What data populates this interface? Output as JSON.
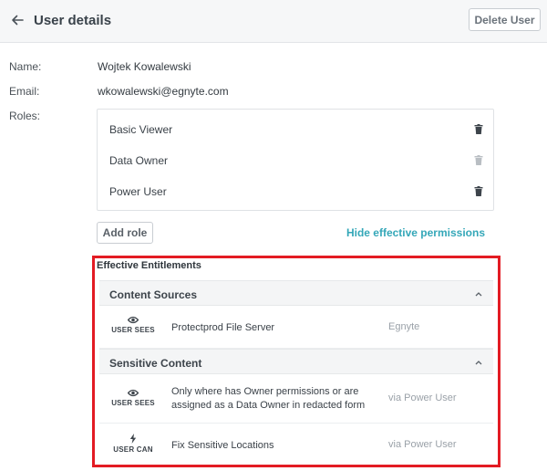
{
  "header": {
    "title": "User details",
    "delete_label": "Delete User"
  },
  "fields": {
    "name_label": "Name:",
    "name_value": "Wojtek Kowalewski",
    "email_label": "Email:",
    "email_value": "wkowalewski@egnyte.com",
    "roles_label": "Roles:"
  },
  "roles": [
    {
      "label": "Basic Viewer",
      "deletable": true
    },
    {
      "label": "Data Owner",
      "deletable": false
    },
    {
      "label": "Power User",
      "deletable": true
    }
  ],
  "actions": {
    "add_role_label": "Add role",
    "hide_permissions_label": "Hide effective permissions"
  },
  "entitlements": {
    "title": "Effective Entitlements",
    "sections": [
      {
        "label": "Content Sources",
        "rows": [
          {
            "icon": "eye-icon",
            "caption": "USER SEES",
            "desc_lines": [
              "Protectprod File Server"
            ],
            "source": "Egnyte"
          }
        ]
      },
      {
        "label": "Sensitive Content",
        "rows": [
          {
            "icon": "eye-icon",
            "caption": "USER SEES",
            "desc_lines": [
              "Only where has Owner permissions or are",
              "assigned as a Data Owner in redacted form"
            ],
            "source": "via Power User"
          },
          {
            "icon": "bolt-icon",
            "caption": "USER CAN",
            "desc_lines": [
              "Fix Sensitive Locations"
            ],
            "source": "via Power User"
          }
        ]
      }
    ]
  },
  "colors": {
    "accent_link": "#34a7b8",
    "highlight_border": "#e31b23",
    "trash_active": "#3d444b",
    "trash_disabled": "#b9bec3"
  }
}
